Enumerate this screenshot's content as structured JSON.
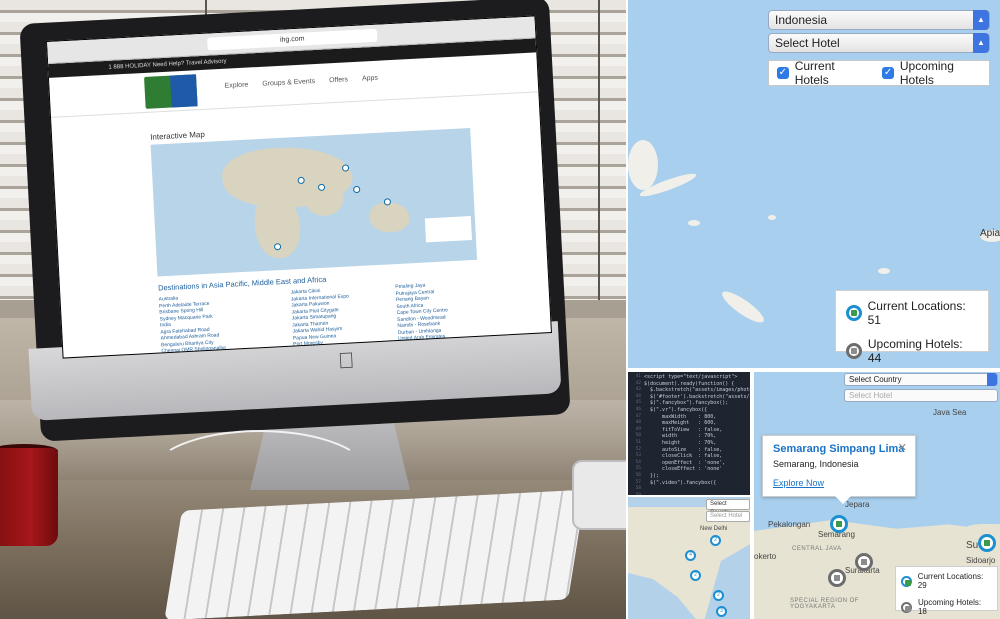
{
  "photo": {
    "browser_url": "ihg.com",
    "ihg_bar_text": "1 888 HOLIDAY   Need Help?   Travel Advisory",
    "brand_logo": "Holiday Inn Express",
    "site_nav": [
      "Explore",
      "Groups & Events",
      "Offers",
      "Apps"
    ],
    "map_title": "Interactive Map",
    "destinations_title": "Destinations in Asia Pacific, Middle East and Africa",
    "col1": [
      "Australia",
      "Perth Adelaide Terrace",
      "Brisbane Spring Hill",
      "Sydney Macquarie Park",
      "India",
      "Agra Fatehabad Road",
      "Ahmedabad Ashram Road",
      "Bengaluru Bhartiya City",
      "Chennai OMR Sholinganallur"
    ],
    "col2": [
      "Jakarta Cikini",
      "Jakarta International Expo",
      "Jakarta Pakuwon",
      "Jakarta Pluit Citygate",
      "Jakarta Simatupang",
      "Jakarta Thamrin",
      "Jakarta Wahid Hasyim",
      "Papua New Guinea",
      "Port Moresby"
    ],
    "col3": [
      "Petaling Jaya",
      "Putrajaya Central",
      "Penang Bayan",
      "South Africa",
      "Cape Town City Centre",
      "Sandton - Woodmead",
      "Nairobi - Rosebank",
      "Durban - Umhlanga",
      "United Arab Emirates"
    ]
  },
  "map_top": {
    "country_value": "Indonesia",
    "hotel_value": "Select Hotel",
    "current_hotels_label": "Current Hotels",
    "upcoming_hotels_label": "Upcoming Hotels",
    "current_locations": "Current Locations: 51",
    "upcoming_hotels": "Upcoming Hotels: 44",
    "edge_label": "Apia",
    "colors": {
      "accent": "#3d74e0",
      "current_pin": "#1b8fd1",
      "upcoming_pin": "#6d6d6d"
    }
  },
  "code": {
    "lines": [
      "<script type=\"text/javascript\">",
      "",
      "$(document).ready(function() {",
      "",
      "  $.backstretch(\"assets/images/photo",
      "  $('#footer').backstretch(\"assets/i",
      "",
      "  $(\".fancybox\").fancybox();",
      "",
      "  $(\".vr\").fancybox({",
      "      maxWidth    : 800,",
      "      maxHeight   : 600,",
      "      fitToView   : false,",
      "      width       : 70%,",
      "      height      : 70%,",
      "      autoSize    : false,",
      "      closeClick  : false,",
      "      openEffect  : 'none',",
      "      closeEffect : 'none'",
      "  });",
      "",
      "  $(\".video\").fancybox({"
    ],
    "line_numbers": [
      "41",
      "42",
      "43",
      "44",
      "45",
      "46",
      "47",
      "48",
      "49",
      "50",
      "51",
      "52",
      "53",
      "54",
      "55",
      "56",
      "57",
      "58",
      "59",
      "60",
      "61",
      "62"
    ]
  },
  "india": {
    "country_placeholder": "Select Country",
    "hotel_placeholder": "Select Hotel",
    "labels": [
      "New Delhi"
    ],
    "pins": [
      "2",
      "4",
      "2",
      "2",
      "3"
    ]
  },
  "java": {
    "country_placeholder": "Select Country",
    "hotel_placeholder": "Select Hotel",
    "sea_label": "Java Sea",
    "popup_title": "Semarang Simpang Lima",
    "popup_sub": "Semarang, Indonesia",
    "popup_link": "Explore Now",
    "city_labels": [
      "Jepara",
      "Pekalongan",
      "Semarang",
      "CENTRAL JAVA",
      "Surakarta",
      "Sidoarjo",
      "Su",
      "okerto",
      "SPECIAL REGION OF YOGYAKARTA"
    ],
    "current_locations": "Current Locations: 29",
    "upcoming_hotels": "Upcoming Hotels: 18"
  }
}
